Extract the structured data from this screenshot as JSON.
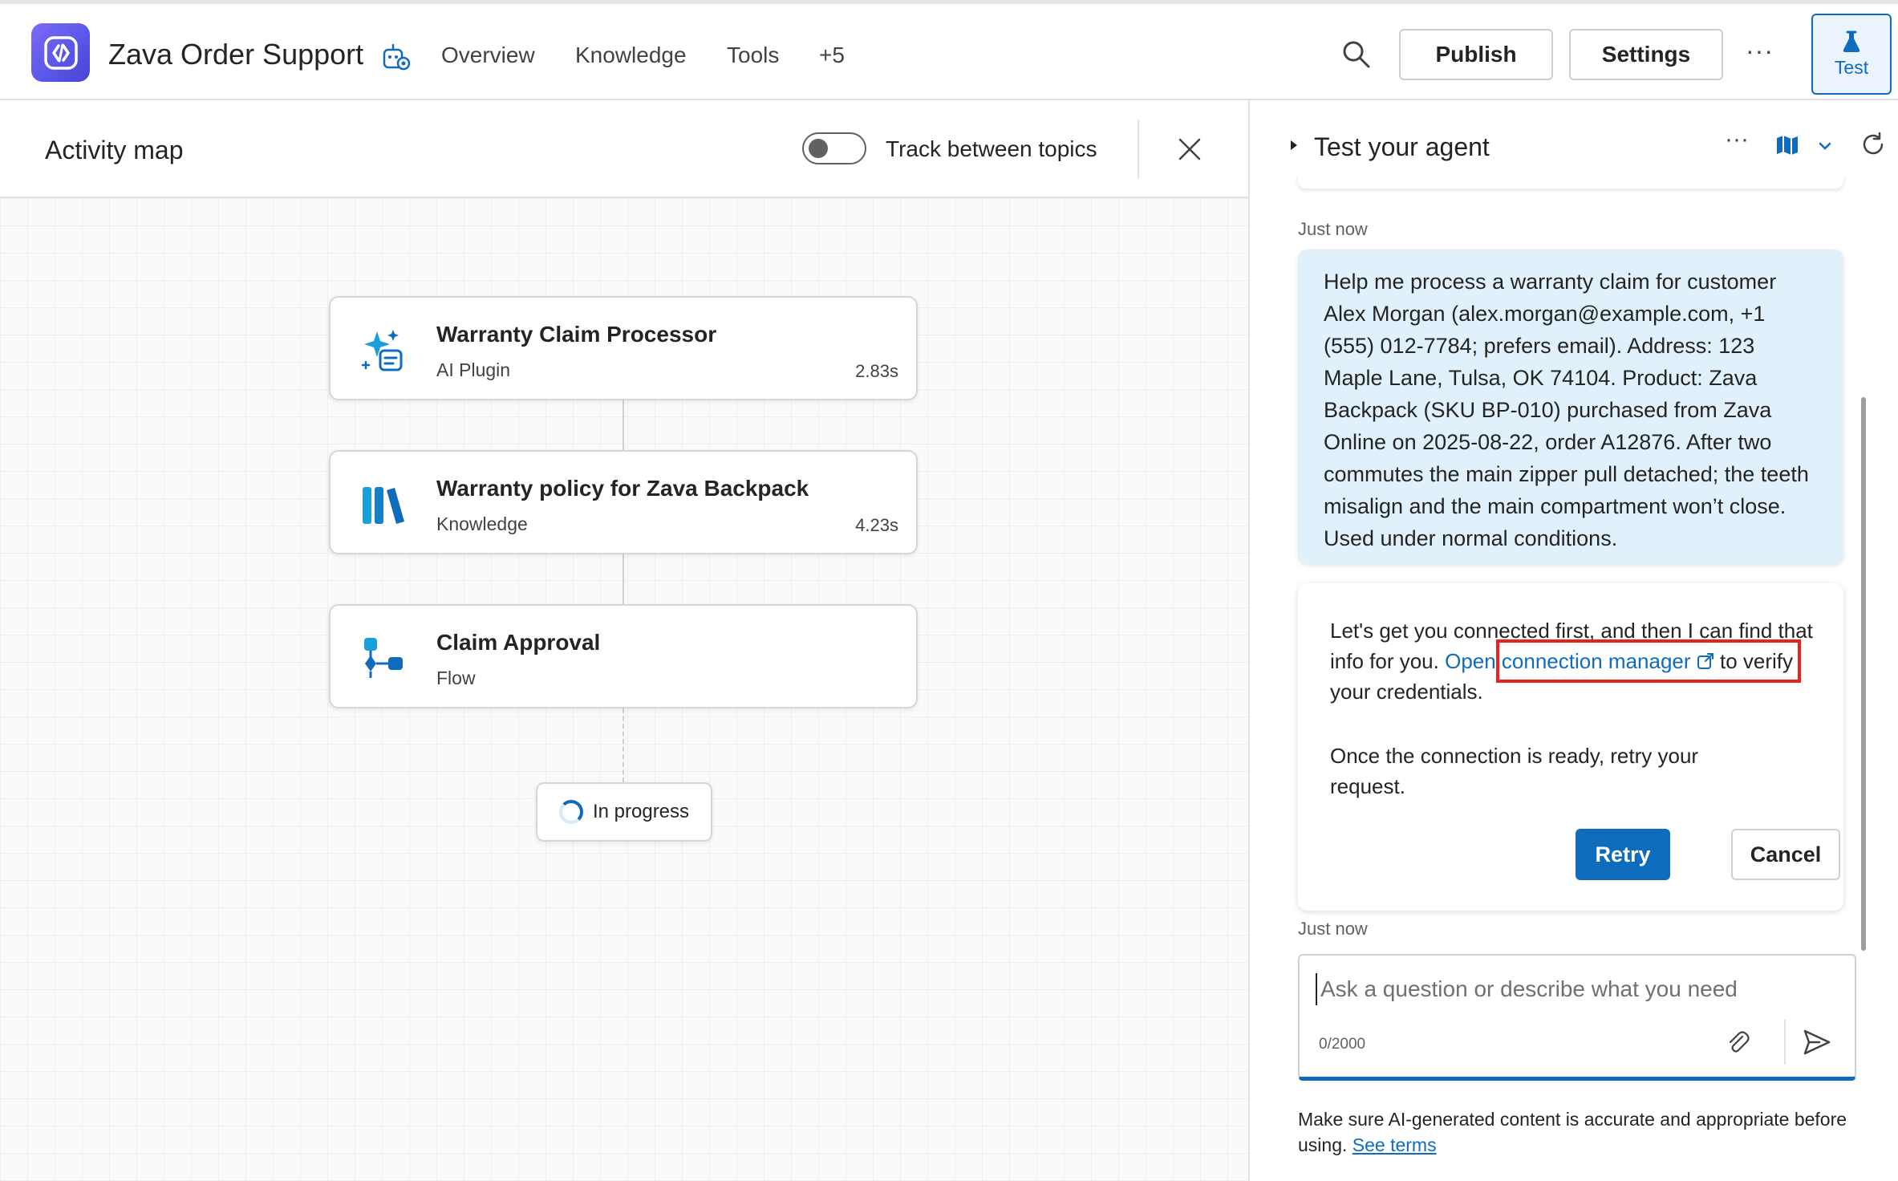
{
  "app": {
    "title": "Zava Order Support"
  },
  "nav": {
    "items": [
      "Overview",
      "Knowledge",
      "Tools",
      "+5"
    ]
  },
  "toolbar": {
    "publish_label": "Publish",
    "settings_label": "Settings",
    "more_label": "···",
    "test_label": "Test"
  },
  "activity": {
    "title": "Activity map",
    "toggle_label": "Track between topics",
    "toggle_on": false,
    "nodes": [
      {
        "title": "Warranty Claim Processor",
        "type": "AI Plugin",
        "time": "2.83s",
        "icon": "sparkle-plugin-icon"
      },
      {
        "title": "Warranty policy for Zava Backpack",
        "type": "Knowledge",
        "time": "4.23s",
        "icon": "books-icon"
      },
      {
        "title": "Claim Approval",
        "type": "Flow",
        "time": "",
        "icon": "flow-icon"
      }
    ],
    "progress_label": "In progress"
  },
  "test_panel": {
    "title": "Test your agent",
    "more_label": "···",
    "timestamp_1": "Just now",
    "user_message": "Help me process a warranty claim for customer Alex Morgan (alex.morgan@example.com, +1 (555) 012-7784; prefers email). Address: 123 Maple Lane, Tulsa, OK 74104. Product: Zava Backpack (SKU BP-010) purchased from Zava Online on 2025-08-22, order A12876. After two commutes the main zipper pull detached; the teeth misalign and the main compartment won’t close. Used under normal conditions.",
    "bot_text_before": "Let's get you connected first, and then I can find that info for you.",
    "bot_link": "Open connection manager",
    "bot_text_after": "to verify your credentials.",
    "bot_text_2": "Once the connection is ready, retry your request.",
    "retry_label": "Retry",
    "cancel_label": "Cancel",
    "timestamp_2": "Just now",
    "input_placeholder": "Ask a question or describe what you need",
    "char_count": "0/2000",
    "disclaimer": "Make sure AI-generated content is accurate and appropriate before using.",
    "terms_link": "See terms"
  },
  "colors": {
    "accent": "#0f6cbd",
    "user_bubble": "#e1f1fb",
    "highlight": "#e8231c",
    "logo": "#5b57e8"
  }
}
